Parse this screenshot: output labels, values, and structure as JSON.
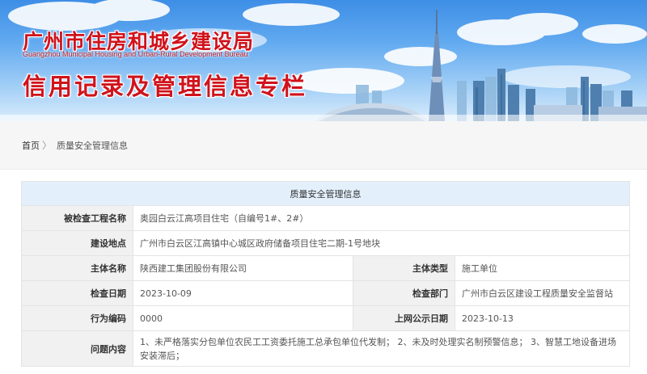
{
  "header": {
    "site_title": "广州市住房和城乡建设局",
    "site_subtitle": "Guangzhou Municipal Housing and Urban-Rural Development Bureau",
    "column_title": "信用记录及管理信息专栏"
  },
  "breadcrumb": {
    "home": "首页",
    "separator": "〉",
    "current": "质量安全管理信息"
  },
  "table": {
    "title": "质量安全管理信息",
    "rows": {
      "project_label": "被检查工程名称",
      "project_value": "奥园白云江高项目住宅（自编号1#、2#）",
      "site_label": "建设地点",
      "site_value": "广州市白云区江高镇中心城区政府储备项目住宅二期-1号地块",
      "entity_label": "主体名称",
      "entity_value": "陕西建工集团股份有限公司",
      "entity_type_label": "主体类型",
      "entity_type_value": "施工单位",
      "inspect_date_label": "检查日期",
      "inspect_date_value": "2023-10-09",
      "inspect_dept_label": "检查部门",
      "inspect_dept_value": "广州市白云区建设工程质量安全监督站",
      "code_label": "行为编码",
      "code_value": "0000",
      "publish_date_label": "上网公示日期",
      "publish_date_value": "2023-10-13",
      "issues_label": "问题内容",
      "issues_value": "1、未严格落实分包单位农民工工资委托施工总承包单位代发制；  2、未及时处理实名制预警信息；  3、智慧工地设备进场安装滞后；"
    }
  },
  "colors": {
    "title_red": "#d0121b",
    "table_header_bg": "#e3f0fb",
    "label_bg": "#f1f1f1",
    "breadcrumb_bg": "#f6f6f6"
  }
}
